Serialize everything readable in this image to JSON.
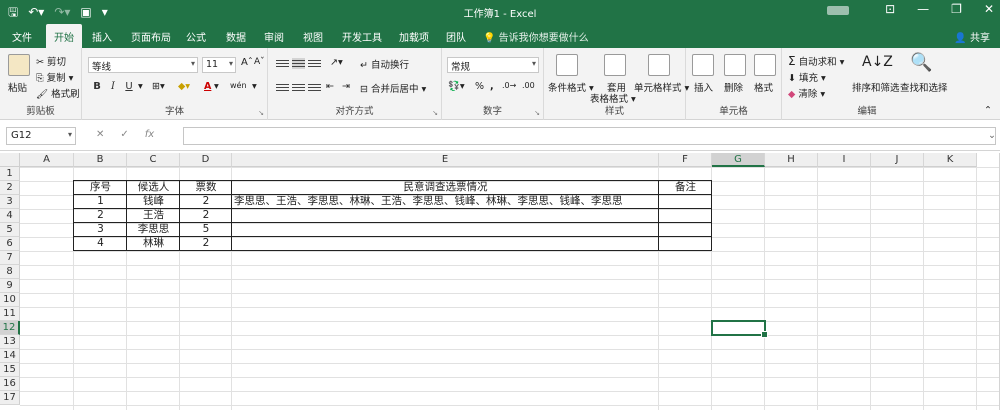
{
  "app": {
    "window_title": "工作簿1 - Excel",
    "user_blurred": "",
    "qat": {
      "save_icon": "save-icon",
      "undo_icon": "undo-icon",
      "redo_icon": "redo-icon",
      "more_icon": "customize-qat-icon"
    }
  },
  "tabs": [
    "文件",
    "开始",
    "插入",
    "页面布局",
    "公式",
    "数据",
    "审阅",
    "视图",
    "开发工具",
    "加载项",
    "团队"
  ],
  "active_tab": "开始",
  "tell_me": "告诉我你想要做什么",
  "share": "共享",
  "ribbon": {
    "clipboard": {
      "label": "剪贴板",
      "paste": "粘贴",
      "cut": "剪切",
      "copy": "复制",
      "format_painter": "格式刷"
    },
    "font": {
      "label": "字体",
      "font_name": "等线",
      "font_size": "11",
      "bold": "B",
      "italic": "I",
      "underline": "U",
      "font_color": "A",
      "phonetic": "wén"
    },
    "alignment": {
      "label": "对齐方式",
      "wrap": "自动换行",
      "merge": "合并后居中"
    },
    "number": {
      "label": "数字",
      "format": "常规",
      "percent": "%",
      "comma": ","
    },
    "styles": {
      "label": "样式",
      "conditional": "条件格式",
      "table_format_1": "套用",
      "table_format_2": "表格格式",
      "cell_styles": "单元格样式"
    },
    "cells": {
      "label": "单元格",
      "insert": "插入",
      "delete": "删除",
      "format": "格式"
    },
    "editing": {
      "label": "编辑",
      "autosum": "自动求和",
      "fill": "填充",
      "clear": "清除",
      "sort": "排序和筛选",
      "find": "查找和选择"
    }
  },
  "formula_bar": {
    "name_box": "G12",
    "fx": "fx",
    "cancel": "✕",
    "enter": "✓",
    "content": ""
  },
  "sheet": {
    "columns": [
      "A",
      "B",
      "C",
      "D",
      "E",
      "F",
      "G",
      "H",
      "I",
      "J",
      "K"
    ],
    "selected_column": "G",
    "rows": [
      "1",
      "2",
      "3",
      "4",
      "5",
      "6",
      "7",
      "8",
      "9",
      "10",
      "11",
      "12",
      "13",
      "14",
      "15",
      "16",
      "17"
    ],
    "selected_row": "12",
    "table": {
      "headers": [
        "序号",
        "候选人",
        "票数",
        "民意调查选票情况",
        "备注"
      ],
      "rows": [
        [
          "1",
          "钱峰",
          "2",
          "李思思、王浩、李思思、林琳、王浩、李思思、钱峰、林琳、李思思、钱峰、李思思",
          ""
        ],
        [
          "2",
          "王浩",
          "2",
          "",
          ""
        ],
        [
          "3",
          "李思思",
          "5",
          "",
          ""
        ],
        [
          "4",
          "林琳",
          "2",
          "",
          ""
        ]
      ]
    }
  }
}
